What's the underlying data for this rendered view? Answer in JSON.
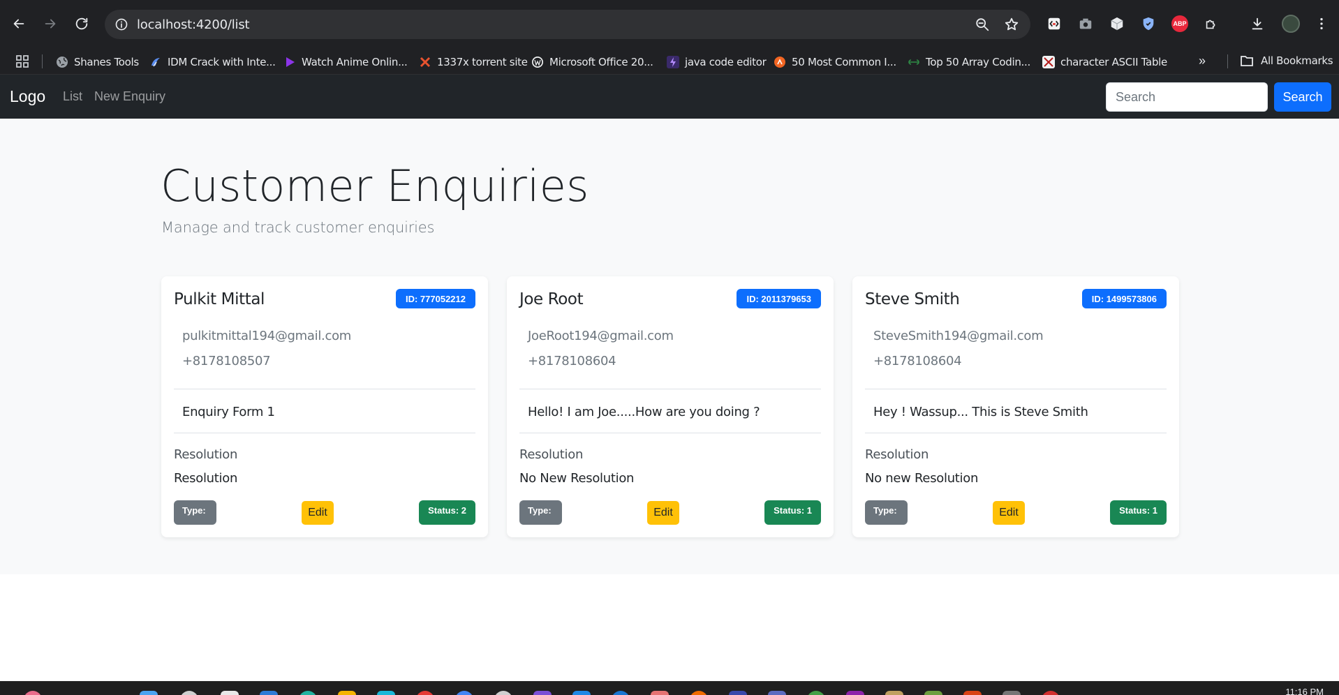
{
  "browser": {
    "url": "localhost:4200/list",
    "bookmarks": [
      {
        "label": "Shanes Tools",
        "icon": "globe-icon"
      },
      {
        "label": "IDM Crack with Inte...",
        "icon": "idm-icon"
      },
      {
        "label": "Watch Anime Onlin...",
        "icon": "play-icon"
      },
      {
        "label": "1337x torrent site",
        "icon": "x-logo-icon"
      },
      {
        "label": "Microsoft Office 20...",
        "icon": "wordpress-icon"
      },
      {
        "label": "java code editor",
        "icon": "bolt-icon"
      },
      {
        "label": "50 Most Common I...",
        "icon": "orange-logo-icon"
      },
      {
        "label": "Top 50 Array Codin...",
        "icon": "gfg-icon"
      },
      {
        "label": "character ASCII Table",
        "icon": "ascii-icon"
      }
    ],
    "all_bookmarks": "All Bookmarks"
  },
  "navbar": {
    "brand": "Logo",
    "links": [
      "List",
      "New Enquiry"
    ],
    "search_placeholder": "Search",
    "search_button": "Search"
  },
  "page": {
    "title": "Customer Enquiries",
    "subtitle": "Manage and track customer enquiries"
  },
  "enquiries": [
    {
      "name": "Pulkit Mittal",
      "id": "ID: 777052212",
      "email": "pulkitmittal194@gmail.com",
      "phone": "+8178108507",
      "message": "Enquiry Form 1",
      "resolution_label": "Resolution",
      "resolution": "Resolution",
      "type": "Type:",
      "edit": "Edit",
      "status": "Status: 2"
    },
    {
      "name": "Joe Root",
      "id": "ID: 2011379653",
      "email": "JoeRoot194@gmail.com",
      "phone": "+8178108604",
      "message": "Hello! I am Joe.....How are you doing ?",
      "resolution_label": "Resolution",
      "resolution": "No New Resolution",
      "type": "Type:",
      "edit": "Edit",
      "status": "Status: 1"
    },
    {
      "name": "Steve Smith",
      "id": "ID: 1499573806",
      "email": "SteveSmith194@gmail.com",
      "phone": "+8178108604",
      "message": "Hey ! Wassup... This is Steve Smith",
      "resolution_label": "Resolution",
      "resolution": "No new Resolution",
      "type": "Type:",
      "edit": "Edit",
      "status": "Status: 1"
    }
  ],
  "taskbar": {
    "clock": "11:16 PM"
  },
  "colors": {
    "primary": "#0d6efd",
    "warning": "#ffc107",
    "success": "#198754",
    "secondary": "#6c757d",
    "navbar": "#212529"
  }
}
